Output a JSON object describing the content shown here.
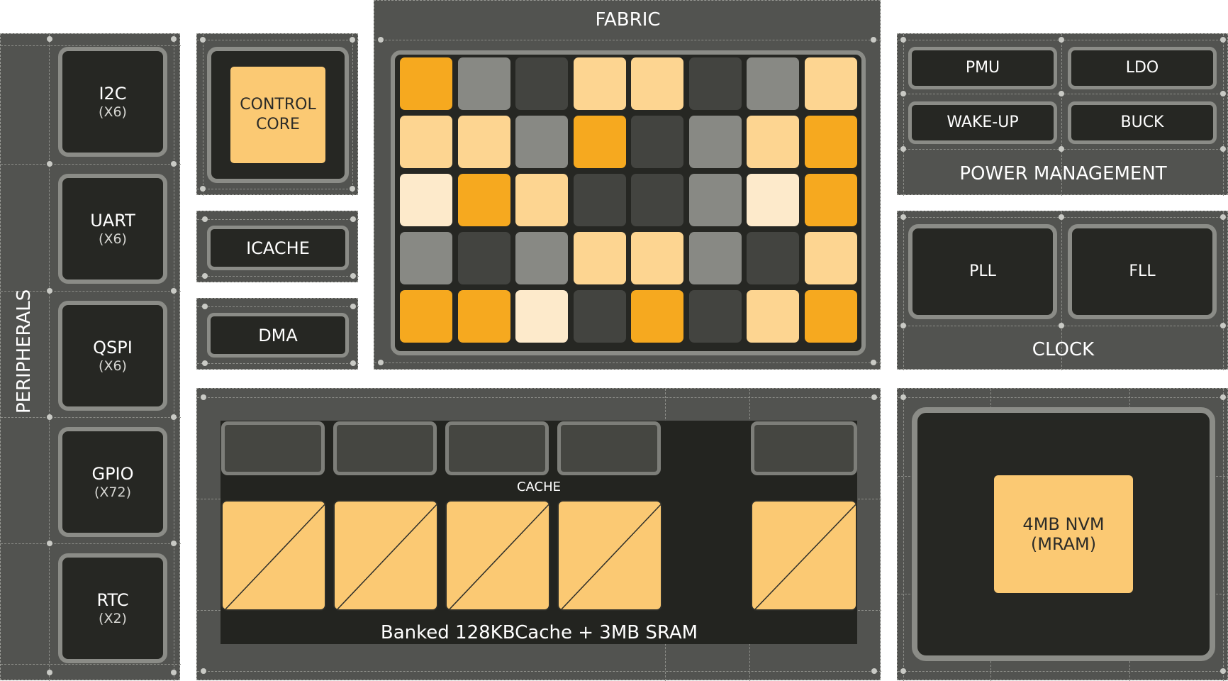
{
  "colors": {
    "panel": "#525350",
    "block_dark": "#262723",
    "block_border": "#8b8c87",
    "accent_orange": "#f6a91f",
    "accent_light": "#fdd591",
    "accent_pale": "#fdeacb",
    "tile_gray": "#888984",
    "tile_dark": "#434440",
    "sram": "#fbc973"
  },
  "peripherals": {
    "title": "PERIPHERALS",
    "blocks": [
      {
        "name": "I2C",
        "count": "(X6)"
      },
      {
        "name": "UART",
        "count": "(X6)"
      },
      {
        "name": "QSPI",
        "count": "(X6)"
      },
      {
        "name": "GPIO",
        "count": "(X72)"
      },
      {
        "name": "RTC",
        "count": "(X2)"
      }
    ]
  },
  "control_core": {
    "line1": "CONTROL",
    "line2": "CORE"
  },
  "icache": {
    "label": "ICACHE"
  },
  "dma": {
    "label": "DMA"
  },
  "fabric": {
    "title": "FABRIC",
    "grid": [
      [
        "O",
        "G",
        "D",
        "L",
        "L",
        "D",
        "G",
        "L"
      ],
      [
        "L",
        "L",
        "G",
        "O",
        "D",
        "G",
        "L",
        "O"
      ],
      [
        "P",
        "O",
        "L",
        "D",
        "D",
        "G",
        "P",
        "O"
      ],
      [
        "G",
        "D",
        "G",
        "L",
        "L",
        "G",
        "D",
        "L"
      ],
      [
        "O",
        "O",
        "P",
        "D",
        "O",
        "D",
        "L",
        "O"
      ]
    ]
  },
  "power": {
    "title": "POWER MANAGEMENT",
    "blocks": [
      "PMU",
      "LDO",
      "WAKE-UP",
      "BUCK"
    ]
  },
  "clock": {
    "title": "CLOCK",
    "blocks": [
      "PLL",
      "FLL"
    ]
  },
  "memory": {
    "cache_label": "CACHE",
    "title": "Banked 128KBCache + 3MB SRAM"
  },
  "nvm": {
    "line1": "4MB NVM",
    "line2": "(MRAM)"
  }
}
